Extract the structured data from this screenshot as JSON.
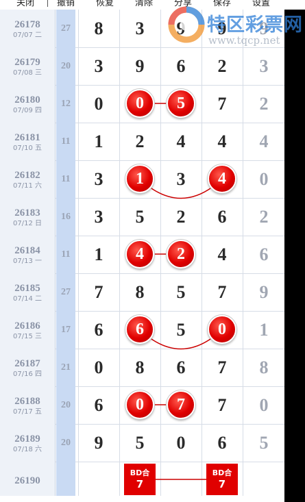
{
  "toolbar": {
    "close": "关闭",
    "cancel": "撤销",
    "restore": "恢复",
    "clear": "清除",
    "share": "分享",
    "save": "保存",
    "settings": "设置"
  },
  "watermark": {
    "name": "特区彩票网",
    "url": "www.tqcp.net"
  },
  "rows": [
    {
      "issue": "26178",
      "date": "07/07 二",
      "sum": "27",
      "nums": [
        "8",
        "3",
        "9",
        "9",
        "9"
      ]
    },
    {
      "issue": "26179",
      "date": "07/08 三",
      "sum": "20",
      "nums": [
        "3",
        "9",
        "6",
        "2",
        "3"
      ]
    },
    {
      "issue": "26180",
      "date": "07/09 四",
      "sum": "12",
      "nums": [
        "0",
        "0",
        "5",
        "7",
        "2"
      ]
    },
    {
      "issue": "26181",
      "date": "07/10 五",
      "sum": "11",
      "nums": [
        "1",
        "2",
        "4",
        "4",
        "4"
      ]
    },
    {
      "issue": "26182",
      "date": "07/11 六",
      "sum": "11",
      "nums": [
        "3",
        "1",
        "3",
        "4",
        "0"
      ]
    },
    {
      "issue": "26183",
      "date": "07/12 日",
      "sum": "16",
      "nums": [
        "3",
        "5",
        "2",
        "6",
        "2"
      ]
    },
    {
      "issue": "26184",
      "date": "07/13 一",
      "sum": "11",
      "nums": [
        "1",
        "4",
        "2",
        "4",
        "6"
      ]
    },
    {
      "issue": "26185",
      "date": "07/14 二",
      "sum": "27",
      "nums": [
        "7",
        "8",
        "5",
        "7",
        "9"
      ]
    },
    {
      "issue": "26186",
      "date": "07/15 三",
      "sum": "17",
      "nums": [
        "6",
        "6",
        "5",
        "0",
        "1"
      ]
    },
    {
      "issue": "26187",
      "date": "07/16 四",
      "sum": "21",
      "nums": [
        "0",
        "8",
        "6",
        "7",
        "8"
      ]
    },
    {
      "issue": "26188",
      "date": "07/17 五",
      "sum": "20",
      "nums": [
        "6",
        "0",
        "7",
        "7",
        "0"
      ]
    },
    {
      "issue": "26189",
      "date": "07/18 六",
      "sum": "20",
      "nums": [
        "9",
        "5",
        "0",
        "6",
        "5"
      ]
    }
  ],
  "next_row": {
    "issue": "26190",
    "bd_left": {
      "label": "BD合",
      "value": "7"
    },
    "bd_right": {
      "label": "BD合",
      "value": "7"
    }
  },
  "colors": {
    "ball": "#e00000",
    "sum_column": "#c9daf3",
    "link_line": "#cc0000"
  }
}
